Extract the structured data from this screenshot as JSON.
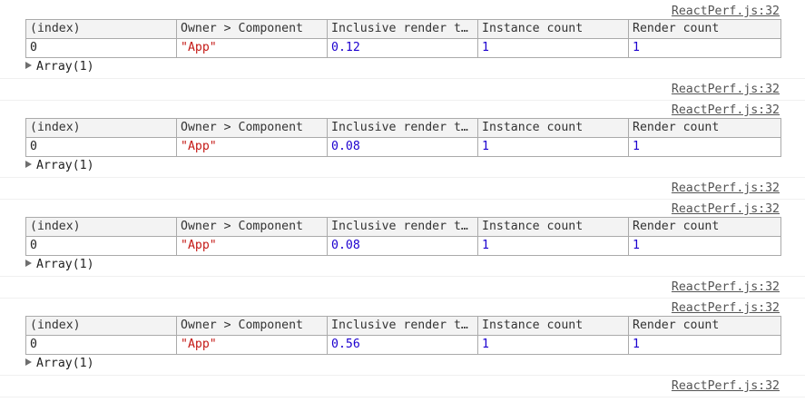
{
  "source_link": "ReactPerf.js:32",
  "columns": [
    "(index)",
    "Owner > Component",
    "Inclusive render t…",
    "Instance count",
    "Render count"
  ],
  "groups": [
    {
      "index": "0",
      "component": "\"App\"",
      "time": "0.12",
      "instances": "1",
      "renders": "1",
      "array_label": "Array(1)"
    },
    {
      "index": "0",
      "component": "\"App\"",
      "time": "0.08",
      "instances": "1",
      "renders": "1",
      "array_label": "Array(1)"
    },
    {
      "index": "0",
      "component": "\"App\"",
      "time": "0.08",
      "instances": "1",
      "renders": "1",
      "array_label": "Array(1)"
    },
    {
      "index": "0",
      "component": "\"App\"",
      "time": "0.56",
      "instances": "1",
      "renders": "1",
      "array_label": "Array(1)"
    }
  ]
}
